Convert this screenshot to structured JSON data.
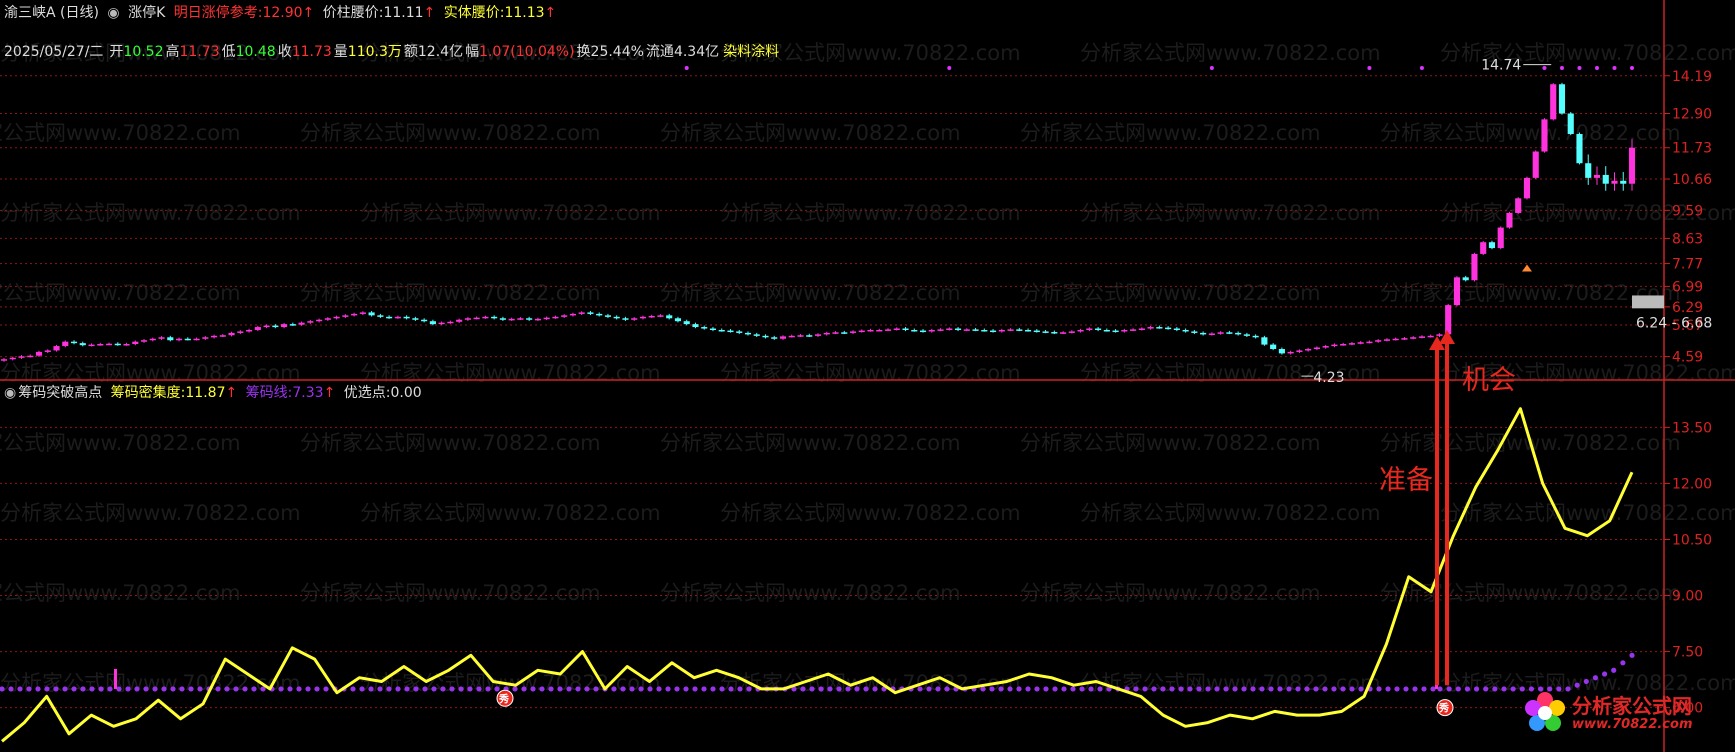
{
  "colors": {
    "up": "#ff33dd",
    "down": "#55ffff",
    "grid": "#8a1a1a",
    "axis": "#cc2222",
    "price_line": "#ffff33",
    "chip_dots": "#9933ee",
    "zone": "#bbbbbb",
    "annotation": "#e8281e"
  },
  "top_header": {
    "stock_name": "渝三峡A (日线)",
    "indicator_name": "涨停K",
    "limit_label": "明日涨停参考:",
    "limit_value": "12.90",
    "mid_label": "价柱腰价:",
    "mid_value": "11.11",
    "body_label": "实体腰价:",
    "body_value": "11.13",
    "up_arrow": "↑"
  },
  "info_bar": {
    "date": "2025/05/27/二",
    "open_label": "开",
    "open": "10.52",
    "high_label": "高",
    "high": "11.73",
    "low_label": "低",
    "low": "10.48",
    "close_label": "收",
    "close": "11.73",
    "vol_label": "量",
    "vol": "110.3万",
    "amt_label": "额",
    "amt": "12.4亿",
    "chg_label": "幅",
    "chg": "1.07(10.04%)",
    "turn_label": "换",
    "turn": "25.44%",
    "float_label": "流通",
    "float": "4.34亿",
    "sector": "染料涂料"
  },
  "bottom_header": {
    "indicator_name": "筹码突破高点",
    "density_label": "筹码密集度:",
    "density_value": "11.87",
    "chip_label": "筹码线:",
    "chip_value": "7.33",
    "pick_label": "优选点:",
    "pick_value": "0.00",
    "up_arrow": "↑"
  },
  "annotations": {
    "high_label": "14.74",
    "low_label": "4.23",
    "zone_label": "6.24 - 6.68",
    "opportunity": "机会",
    "prepare": "准备",
    "marker1": "秀",
    "marker2": "秀"
  },
  "watermark": "分析家公式网www.70822.com",
  "logo": {
    "name": "分析家公式网",
    "url": "www.70822.com"
  },
  "chart_data": [
    {
      "type": "candlestick",
      "y_ticks": [
        "14.19",
        "12.90",
        "11.73",
        "10.66",
        "9.59",
        "8.63",
        "7.77",
        "6.99",
        "6.29",
        "5.67",
        "4.59"
      ],
      "close_series": [
        4.5,
        4.55,
        4.6,
        4.62,
        4.75,
        4.8,
        4.95,
        5.1,
        5.05,
        4.98,
        5.0,
        5.02,
        5.03,
        5.0,
        5.02,
        5.1,
        5.15,
        5.2,
        5.25,
        5.15,
        5.2,
        5.18,
        5.2,
        5.25,
        5.3,
        5.32,
        5.4,
        5.45,
        5.5,
        5.6,
        5.65,
        5.6,
        5.7,
        5.68,
        5.75,
        5.8,
        5.85,
        5.9,
        5.95,
        6.0,
        6.05,
        6.1,
        6.0,
        5.95,
        5.92,
        5.95,
        5.9,
        5.85,
        5.8,
        5.7,
        5.75,
        5.78,
        5.85,
        5.9,
        5.92,
        5.95,
        5.9,
        5.85,
        5.88,
        5.9,
        5.85,
        5.88,
        5.92,
        5.95,
        6.0,
        6.05,
        6.1,
        6.05,
        6.0,
        5.95,
        5.9,
        5.85,
        5.9,
        5.95,
        5.98,
        6.0,
        5.9,
        5.8,
        5.7,
        5.6,
        5.55,
        5.5,
        5.48,
        5.45,
        5.4,
        5.35,
        5.3,
        5.25,
        5.2,
        5.28,
        5.3,
        5.32,
        5.3,
        5.35,
        5.4,
        5.42,
        5.4,
        5.45,
        5.48,
        5.5,
        5.5,
        5.52,
        5.55,
        5.5,
        5.48,
        5.45,
        5.5,
        5.52,
        5.55,
        5.5,
        5.52,
        5.5,
        5.48,
        5.45,
        5.5,
        5.52,
        5.5,
        5.48,
        5.45,
        5.43,
        5.4,
        5.42,
        5.45,
        5.5,
        5.55,
        5.5,
        5.48,
        5.45,
        5.5,
        5.52,
        5.55,
        5.6,
        5.58,
        5.55,
        5.5,
        5.45,
        5.4,
        5.35,
        5.38,
        5.42,
        5.4,
        5.35,
        5.3,
        5.25,
        5.0,
        4.85,
        4.7,
        4.75,
        4.8,
        4.85,
        4.9,
        4.95,
        5.0,
        5.02,
        5.05,
        5.08,
        5.1,
        5.15,
        5.18,
        5.2,
        5.22,
        5.25,
        5.28,
        5.3,
        5.35,
        6.35,
        7.3,
        7.2,
        8.1,
        8.5,
        8.3,
        9.0,
        9.5,
        10.0,
        10.7,
        11.6,
        12.7,
        13.9,
        12.9,
        12.2,
        11.2,
        10.7,
        10.8,
        10.5,
        10.6,
        10.5,
        11.73
      ],
      "period_high": "14.74",
      "period_low": "4.23"
    },
    {
      "type": "line",
      "y_ticks": [
        "13.50",
        "12.00",
        "10.50",
        "9.00",
        "7.50",
        "6.00"
      ],
      "series": [
        {
          "values": [
            5.1,
            5.6,
            6.3,
            5.3,
            5.8,
            5.5,
            5.7,
            6.2,
            5.7,
            6.1,
            7.3,
            6.9,
            6.5,
            7.6,
            7.3,
            6.4,
            6.8,
            6.7,
            7.1,
            6.7,
            7.0,
            7.4,
            6.7,
            6.6,
            7.0,
            6.9,
            7.5,
            6.5,
            7.1,
            6.7,
            7.2,
            6.8,
            7.0,
            6.8,
            6.5,
            6.5,
            6.7,
            6.9,
            6.6,
            6.8,
            6.4,
            6.6,
            6.8,
            6.5,
            6.6,
            6.7,
            6.9,
            6.8,
            6.6,
            6.7,
            6.5,
            6.3,
            5.8,
            5.5,
            5.6,
            5.8,
            5.7,
            5.9,
            5.8,
            5.8,
            5.9,
            6.3,
            7.7,
            9.5,
            9.1,
            10.6,
            11.9,
            12.9,
            14.0,
            12.0,
            10.8,
            10.6,
            11.0,
            12.3
          ]
        },
        {
          "values": [
            6.5,
            6.5,
            6.5,
            6.5,
            6.5,
            6.5,
            6.5,
            6.5,
            6.5,
            6.5,
            6.5,
            6.5,
            6.5,
            6.5,
            6.5,
            6.6,
            6.7,
            6.8,
            6.9,
            7.0,
            7.2,
            7.4
          ]
        }
      ]
    }
  ]
}
